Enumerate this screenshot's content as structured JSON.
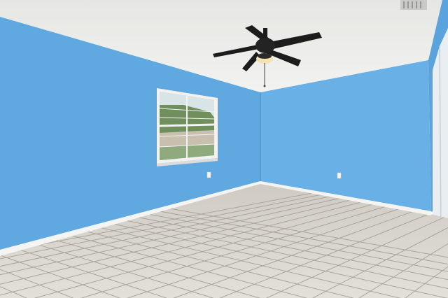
{
  "scene": {
    "type": "empty bedroom interior",
    "colors": {
      "wall_left": "#5fa8e0",
      "wall_back": "#69b0e6",
      "wall_right": "#5aa3dd",
      "ceiling": "#eeeeec",
      "floor_tile": "#d9d6cf",
      "grout": "#a9a49a",
      "baseboard": "#f4f4f2",
      "fan": "#1c1c1c",
      "fan_light": "#f3e2b0",
      "window_frame": "#f2f2f2"
    },
    "icons": [
      "ceiling-fan-icon",
      "window-icon",
      "outlet-icon",
      "ceiling-vent-icon"
    ]
  }
}
